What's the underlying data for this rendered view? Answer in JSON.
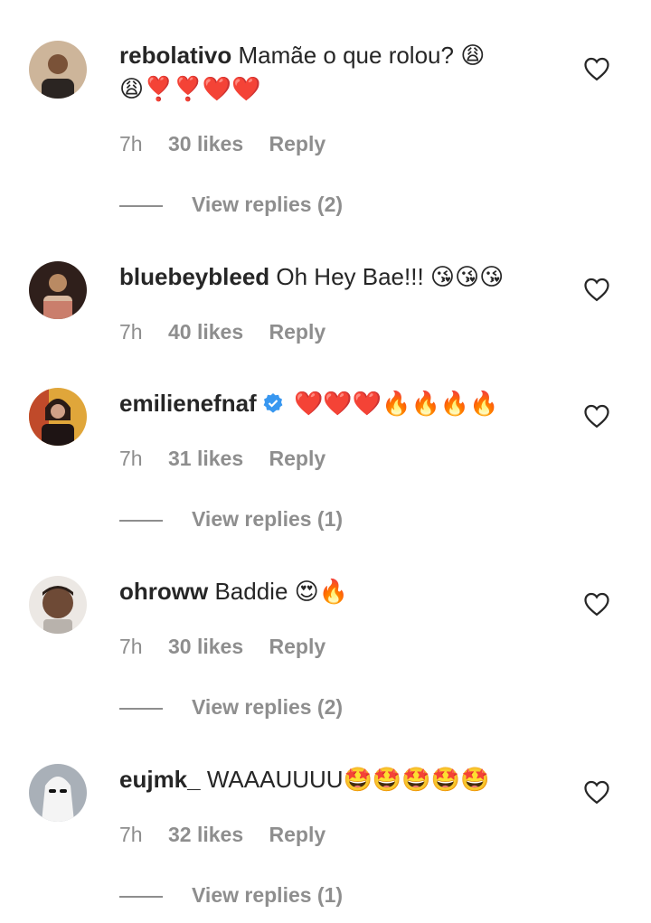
{
  "comments": [
    {
      "username": "rebolativo",
      "text": "Mamãe o que rolou? 😩",
      "text2": "😩❣️❣️❤️❤️",
      "time": "7h",
      "likes": "30 likes",
      "reply": "Reply",
      "view_replies": "View replies (2)",
      "avatar_colors": [
        "#c9a98c",
        "#6b4a34"
      ]
    },
    {
      "username": "bluebeybleed",
      "text": "Oh Hey Bae!!! 😘😘😘",
      "time": "7h",
      "likes": "40 likes",
      "reply": "Reply",
      "avatar_colors": [
        "#3a2520",
        "#b07a55"
      ]
    },
    {
      "username": "emilienefnaf",
      "verified": true,
      "text": "❤️❤️❤️🔥🔥🔥🔥",
      "time": "7h",
      "likes": "31 likes",
      "reply": "Reply",
      "view_replies": "View replies (1)",
      "avatar_colors": [
        "#d8a23a",
        "#2a1c18"
      ]
    },
    {
      "username": "ohroww",
      "text": "Baddie 😍🔥",
      "time": "7h",
      "likes": "30 likes",
      "reply": "Reply",
      "view_replies": "View replies (2)",
      "avatar_colors": [
        "#e8e4e0",
        "#6a4a38"
      ]
    },
    {
      "username": "eujmk_",
      "text": "WAAAUUUU🤩🤩🤩🤩🤩",
      "time": "7h",
      "likes": "32 likes",
      "reply": "Reply",
      "view_replies": "View replies (1)",
      "avatar_colors": [
        "#aab0b6",
        "#ffffff"
      ]
    }
  ],
  "colors": {
    "meta_gray": "#8e8e8e",
    "text": "#262626",
    "verified_blue": "#3897f0"
  },
  "icons": {
    "like": "heart-outline-icon",
    "verified": "verified-badge-icon"
  }
}
